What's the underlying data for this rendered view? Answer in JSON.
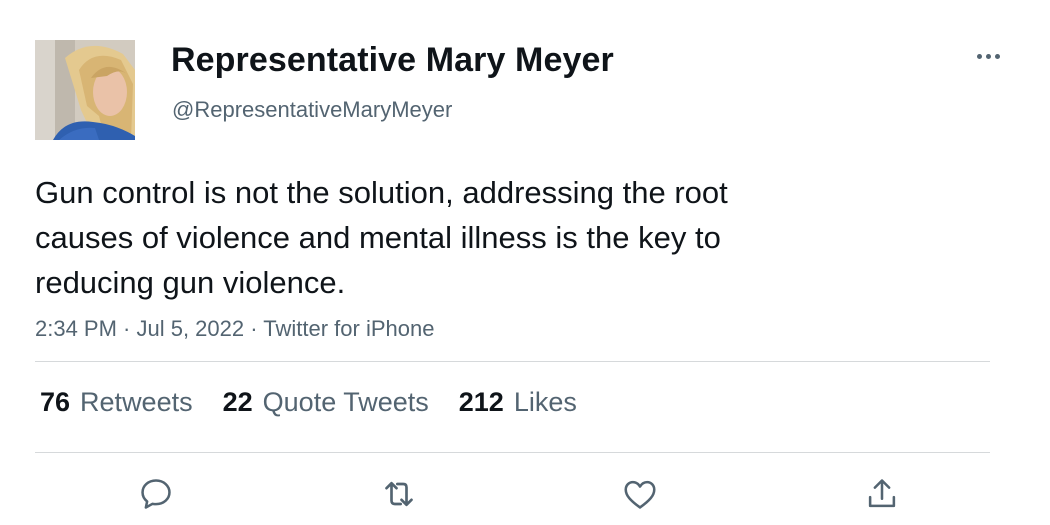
{
  "author": {
    "name": "Representative Mary Meyer",
    "handle": "@RepresentativeMaryMeyer"
  },
  "tweet": {
    "text": "Gun control is not the solution, addressing the root\ncauses of violence and mental illness is the key to\nreducing gun violence.",
    "meta": "2:34 PM · Jul 5, 2022 · Twitter for iPhone"
  },
  "stats": {
    "retweets_count": "76",
    "retweets_label": "Retweets",
    "quotes_count": "22",
    "quotes_label": "Quote Tweets",
    "likes_count": "212",
    "likes_label": "Likes"
  },
  "icons": {
    "more": "more-dots-icon",
    "reply": "reply-bubble-icon",
    "retweet": "retweet-arrows-icon",
    "like": "heart-icon",
    "share": "share-upload-icon"
  },
  "colors": {
    "primary_text": "#0f1419",
    "secondary_text": "#536471",
    "divider": "#d6d9db",
    "icon": "#536471"
  }
}
